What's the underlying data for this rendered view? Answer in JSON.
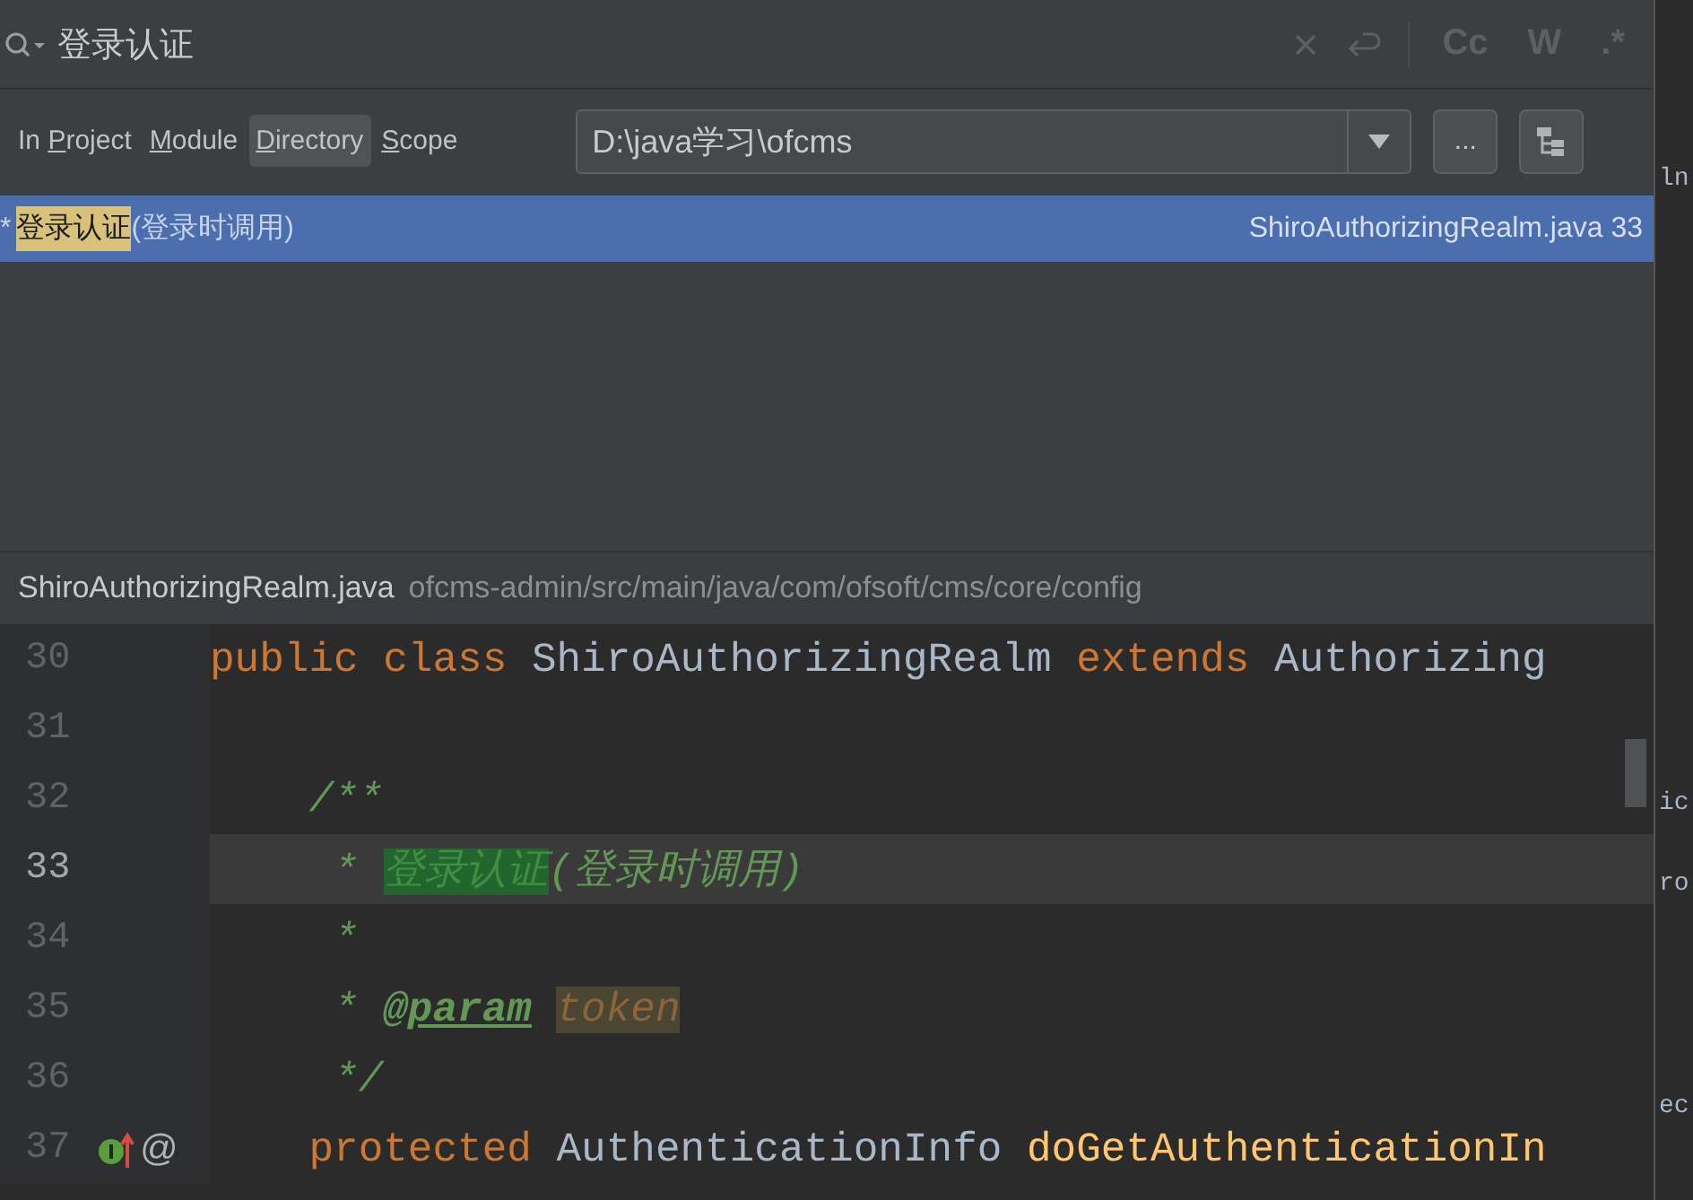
{
  "search": {
    "value": "登录认证",
    "toggles": [
      {
        "label": "Cc",
        "selected": false
      },
      {
        "label": "W",
        "selected": false
      },
      {
        "label": ".*",
        "selected": false
      }
    ]
  },
  "scopes": [
    {
      "before": "In ",
      "key": "P",
      "after": "roject",
      "selected": false
    },
    {
      "key": "M",
      "after": "odule",
      "selected": false
    },
    {
      "key": "D",
      "after": "irectory",
      "selected": true
    },
    {
      "key": "S",
      "after": "cope",
      "selected": false
    }
  ],
  "directory": {
    "value": "D:\\java学习\\ofcms",
    "browse": "..."
  },
  "results": [
    {
      "prefix": "*",
      "match": "登录认证",
      "rest": "(登录时调用)",
      "location": "ShiroAuthorizingRealm.java 33",
      "selected": true
    }
  ],
  "preview": {
    "file": "ShiroAuthorizingRealm.java",
    "path": "ofcms-admin/src/main/java/com/ofsoft/cms/core/config"
  },
  "code": [
    {
      "number": "30",
      "current": false,
      "tokens": [
        {
          "kind": "keyword",
          "text": "public class "
        },
        {
          "kind": "plain",
          "text": "ShiroAuthorizingRealm "
        },
        {
          "kind": "keyword",
          "text": "extends "
        },
        {
          "kind": "plain",
          "text": "Authorizing"
        }
      ]
    },
    {
      "number": "31",
      "current": false
    },
    {
      "number": "32",
      "current": false,
      "tokens": [
        {
          "kind": "comment",
          "text": "    /**"
        }
      ]
    },
    {
      "number": "33",
      "current": true,
      "tokens": [
        {
          "kind": "comment",
          "text": "     * "
        },
        {
          "kind": "match",
          "text": "登录认证"
        },
        {
          "kind": "comment",
          "text": "(登录时调用)"
        }
      ]
    },
    {
      "number": "34",
      "current": false,
      "tokens": [
        {
          "kind": "comment",
          "text": "     *"
        }
      ]
    },
    {
      "number": "35",
      "current": false,
      "tokens": [
        {
          "kind": "comment",
          "text": "     * "
        },
        {
          "kind": "doctag",
          "text": "@param"
        },
        {
          "kind": "param",
          "text": "token"
        }
      ]
    },
    {
      "number": "36",
      "current": false,
      "tokens": [
        {
          "kind": "comment",
          "text": "     */"
        }
      ]
    },
    {
      "number": "37",
      "current": false,
      "gutter": [
        {
          "kind": "implements"
        },
        {
          "kind": "text",
          "text": "@"
        }
      ],
      "tokens": [
        {
          "kind": "keyword",
          "text": "    protected "
        },
        {
          "kind": "plain",
          "text": "AuthenticationInfo "
        },
        {
          "kind": "method",
          "text": "doGetAuthenticationIn"
        }
      ]
    }
  ],
  "behind": [
    "ln",
    "ic",
    "ro",
    "ec"
  ]
}
